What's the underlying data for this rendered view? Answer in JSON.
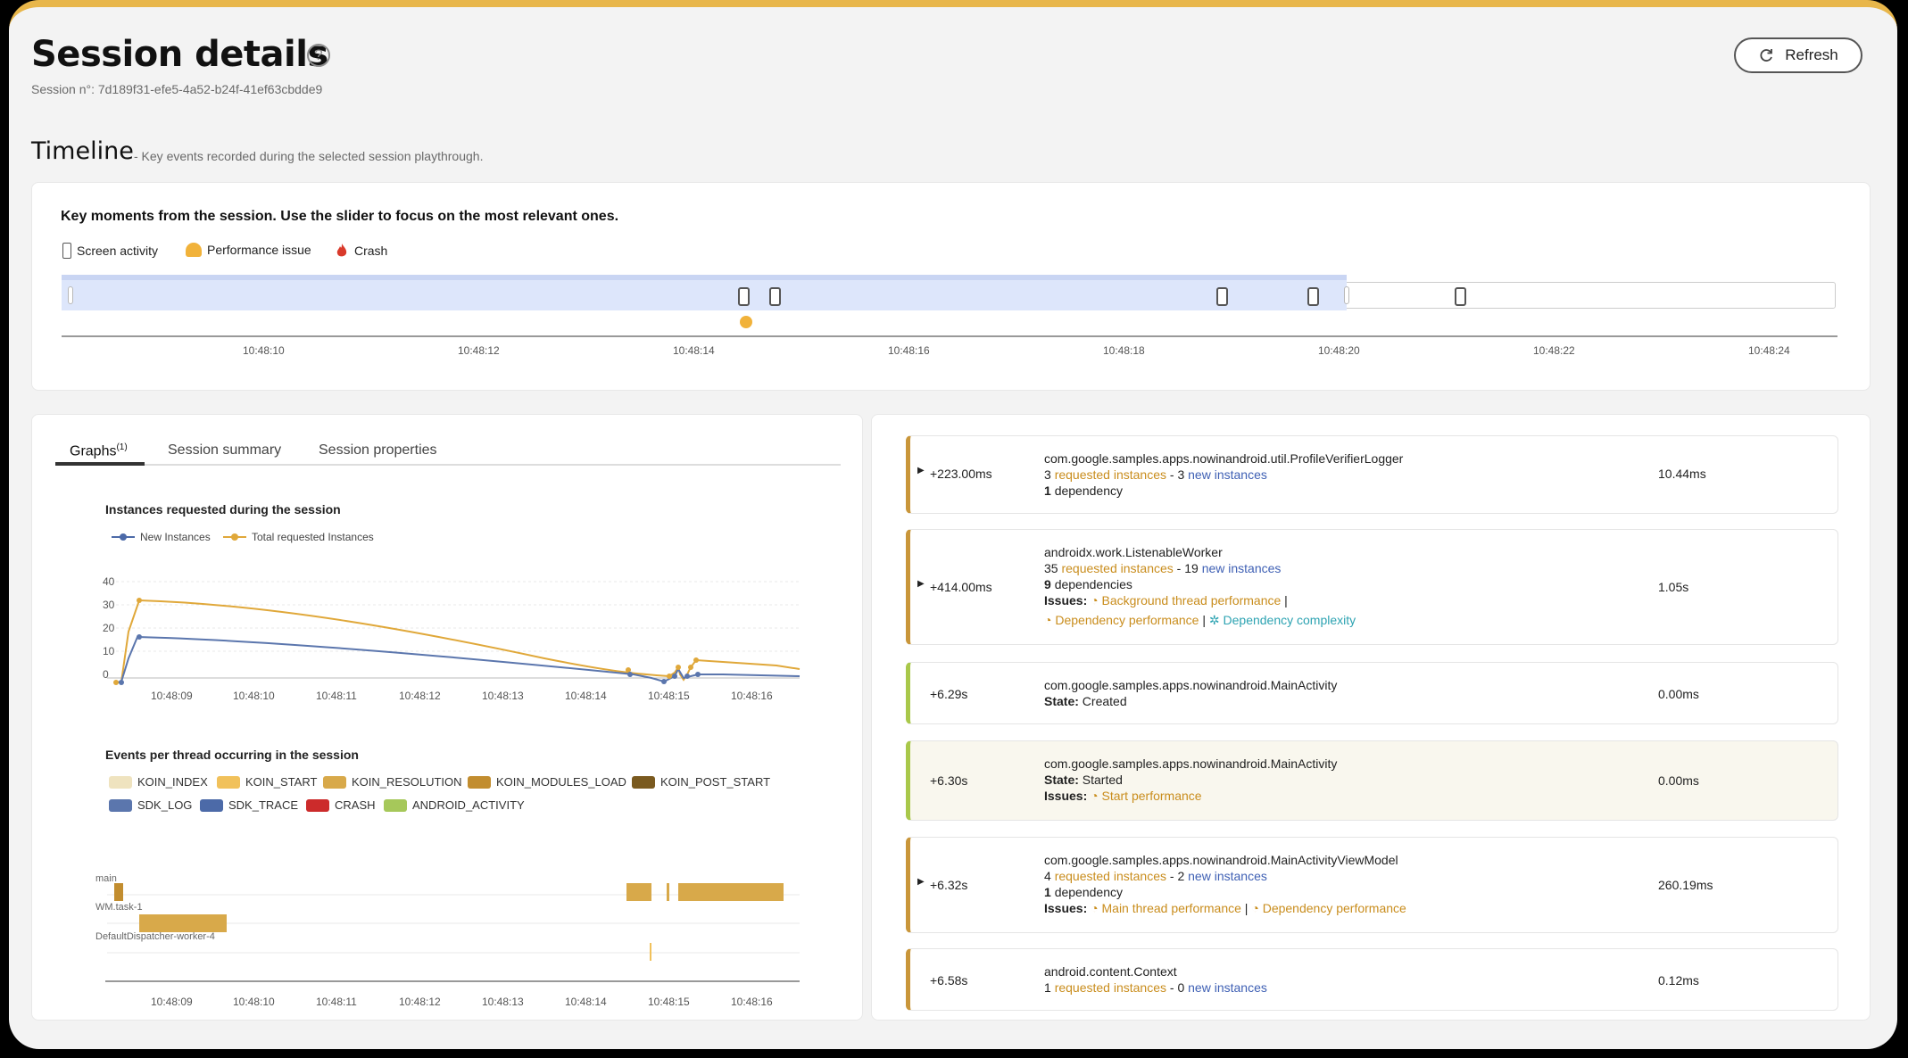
{
  "header": {
    "title": "Session details",
    "help_glyph": "?",
    "session_id": "Session n°: 7d189f31-efe5-4a52-b24f-41ef63cbdde9",
    "refresh_label": "Refresh"
  },
  "timeline": {
    "title": "Timeline",
    "subtitle": "- Key events recorded during the selected session playthrough.",
    "description": "Key moments from the session. Use the slider to focus on the most relevant ones.",
    "legend": {
      "screen_activity": "Screen activity",
      "performance_issue": "Performance issue",
      "crash": "Crash"
    },
    "ticks": [
      "10:48:10",
      "10:48:12",
      "10:48:14",
      "10:48:16",
      "10:48:18",
      "10:48:20",
      "10:48:22",
      "10:48:24"
    ]
  },
  "tabs": {
    "graphs": "Graphs",
    "graphs_sup": "(1)",
    "summary": "Session summary",
    "properties": "Session properties"
  },
  "instances_chart": {
    "title": "Instances requested during the session",
    "legend_new": "New Instances",
    "legend_total": "Total requested Instances",
    "y_ticks": [
      "40",
      "30",
      "20",
      "10",
      "0"
    ],
    "x_ticks": [
      "10:48:09",
      "10:48:10",
      "10:48:11",
      "10:48:12",
      "10:48:13",
      "10:48:14",
      "10:48:15",
      "10:48:16"
    ]
  },
  "threads_chart": {
    "title": "Events per thread occurring in the session",
    "legend": [
      "KOIN_INDEX",
      "KOIN_START",
      "KOIN_RESOLUTION",
      "KOIN_MODULES_LOAD",
      "KOIN_POST_START",
      "SDK_LOG",
      "SDK_TRACE",
      "CRASH",
      "ANDROID_ACTIVITY"
    ],
    "legend_colors": [
      "#efe3bf",
      "#f1c15b",
      "#d8a94a",
      "#c28d2f",
      "#7a5a1f",
      "#5b76ad",
      "#4c6aa8",
      "#cc2b2b",
      "#a6c85a"
    ],
    "rows": [
      "main",
      "WM.task-1",
      "DefaultDispatcher-worker-4"
    ],
    "x_ticks": [
      "10:48:09",
      "10:48:10",
      "10:48:11",
      "10:48:12",
      "10:48:13",
      "10:48:14",
      "10:48:15",
      "10:48:16"
    ]
  },
  "events": [
    {
      "time": "+223.00ms",
      "name": "com.google.samples.apps.nowinandroid.util.ProfileVerifierLogger",
      "req_count": "3",
      "req_label": "requested instances",
      "sep": "-",
      "new_count": "3",
      "new_label": "new instances",
      "deps_count": "1",
      "deps_label": "dependency",
      "duration": "10.44ms"
    },
    {
      "time": "+414.00ms",
      "name": "androidx.work.ListenableWorker",
      "req_count": "35",
      "req_label": "requested instances",
      "sep": "-",
      "new_count": "19",
      "new_label": "new instances",
      "deps_count": "9",
      "deps_label": "dependencies",
      "issues_label": "Issues:",
      "issue1": "Background thread performance",
      "issue2": "Dependency performance",
      "issue3": "Dependency complexity",
      "duration": "1.05s"
    },
    {
      "time": "+6.29s",
      "name": "com.google.samples.apps.nowinandroid.MainActivity",
      "state_label": "State:",
      "state": "Created",
      "duration": "0.00ms"
    },
    {
      "time": "+6.30s",
      "name": "com.google.samples.apps.nowinandroid.MainActivity",
      "state_label": "State:",
      "state": "Started",
      "issues_label": "Issues:",
      "issue1": "Start performance",
      "duration": "0.00ms"
    },
    {
      "time": "+6.32s",
      "name": "com.google.samples.apps.nowinandroid.MainActivityViewModel",
      "req_count": "4",
      "req_label": "requested instances",
      "sep": "-",
      "new_count": "2",
      "new_label": "new instances",
      "deps_count": "1",
      "deps_label": "dependency",
      "issues_label": "Issues:",
      "issue1": "Main thread performance",
      "issue2": "Dependency performance",
      "duration": "260.19ms"
    },
    {
      "time": "+6.58s",
      "name": "android.content.Context",
      "req_count": "1",
      "req_label": "requested instances",
      "sep": "-",
      "new_count": "0",
      "new_label": "new instances",
      "duration": "0.12ms"
    }
  ],
  "colors": {
    "accent_top": "#e8b64a",
    "orange": "#c98d1d",
    "blue": "#3f60b4",
    "event_border_orange": "#c9963a",
    "event_border_green": "#a9c84a"
  }
}
